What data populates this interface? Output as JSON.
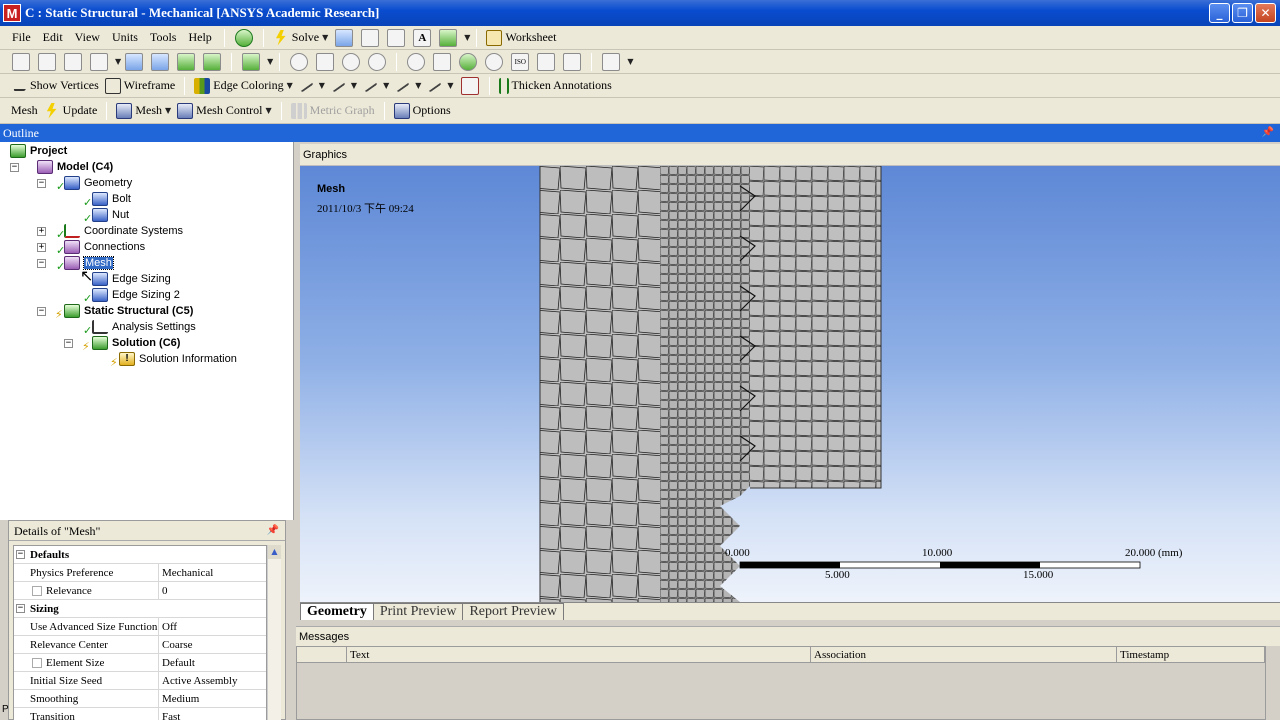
{
  "window": {
    "title": "C : Static Structural - Mechanical [ANSYS Academic Research]",
    "app_icon_letter": "M"
  },
  "menu": {
    "items": [
      "File",
      "Edit",
      "View",
      "Units",
      "Tools",
      "Help"
    ],
    "solve_label": "Solve",
    "worksheet_label": "Worksheet"
  },
  "toolbar3": {
    "show_vertices": "Show Vertices",
    "wireframe": "Wireframe",
    "edge_coloring": "Edge Coloring",
    "thicken_annotations": "Thicken Annotations"
  },
  "toolbar4": {
    "mesh_label": "Mesh",
    "update": "Update",
    "mesh_dropdown": "Mesh",
    "mesh_control": "Mesh Control",
    "metric_graph": "Metric Graph",
    "options": "Options"
  },
  "outline": {
    "title": "Outline",
    "tree": [
      {
        "label": "Project"
      },
      {
        "label": "Model (C4)"
      },
      {
        "label": "Geometry"
      },
      {
        "label": "Bolt"
      },
      {
        "label": "Nut"
      },
      {
        "label": "Coordinate Systems"
      },
      {
        "label": "Connections"
      },
      {
        "label": "Mesh"
      },
      {
        "label": "Edge Sizing"
      },
      {
        "label": "Edge Sizing 2"
      },
      {
        "label": "Static Structural (C5)"
      },
      {
        "label": "Analysis Settings"
      },
      {
        "label": "Solution (C6)"
      },
      {
        "label": "Solution Information"
      }
    ]
  },
  "details": {
    "title": "Details of \"Mesh\"",
    "groups": [
      {
        "name": "Defaults",
        "rows": [
          {
            "key": "Physics Preference",
            "value": "Mechanical"
          },
          {
            "key": "Relevance",
            "value": "0"
          }
        ]
      },
      {
        "name": "Sizing",
        "rows": [
          {
            "key": "Use Advanced Size Function",
            "value": "Off"
          },
          {
            "key": "Relevance Center",
            "value": "Coarse"
          },
          {
            "key": "Element Size",
            "value": "Default"
          },
          {
            "key": "Initial Size Seed",
            "value": "Active Assembly"
          },
          {
            "key": "Smoothing",
            "value": "Medium"
          },
          {
            "key": "Transition",
            "value": "Fast"
          }
        ]
      }
    ]
  },
  "graphics": {
    "header": "Graphics",
    "view_title": "Mesh",
    "view_date": "2011/10/3 下午 09:24",
    "scale": {
      "top_labels": [
        "0.000",
        "10.000",
        "20.000 (mm)"
      ],
      "bottom_labels": [
        "5.000",
        "15.000"
      ]
    },
    "tabs": [
      "Geometry",
      "Print Preview",
      "Report Preview"
    ]
  },
  "messages": {
    "title": "Messages",
    "columns": [
      "Text",
      "Association",
      "Timestamp"
    ]
  },
  "statusbar": {
    "left": "P"
  },
  "colors": {
    "title_bar": "#0a4ccf",
    "outline_header": "#2166d9",
    "mesh_fill": "#bdbdbd"
  }
}
